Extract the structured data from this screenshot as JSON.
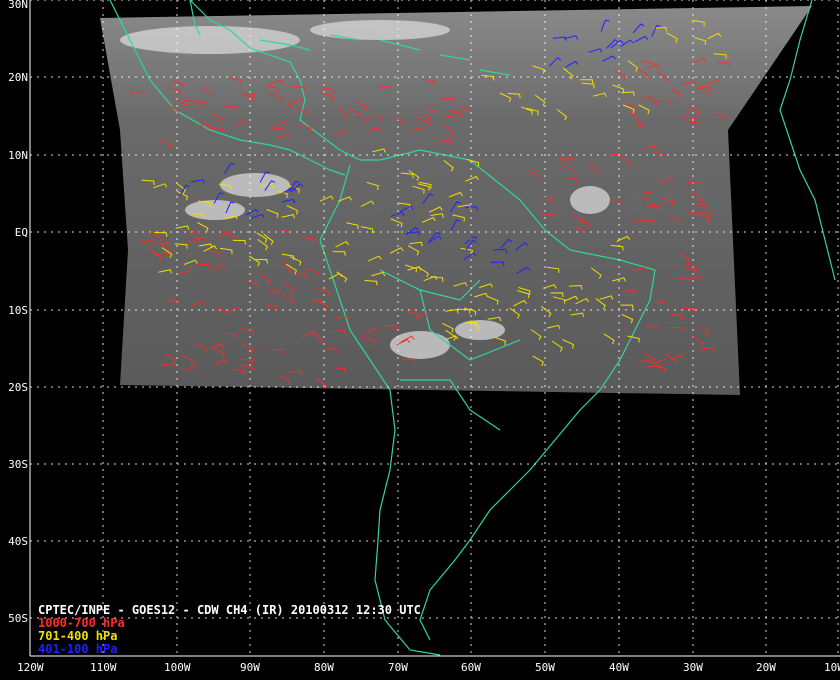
{
  "caption": {
    "title": "CPTEC/INPE - GOES12 - CDW CH4 (IR) 20100312 12:30 UTC",
    "legend": [
      {
        "label": "1000-700 hPa",
        "color": "#ff2a2a"
      },
      {
        "label": "701-400 hPa",
        "color": "#f0e000"
      },
      {
        "label": "401-100 hPa",
        "color": "#2020ff"
      }
    ]
  },
  "axes": {
    "lat_labels": [
      "30N",
      "20N",
      "10N",
      "EQ",
      "10S",
      "20S",
      "30S",
      "40S",
      "50S"
    ],
    "lon_labels": [
      "120W",
      "110W",
      "100W",
      "90W",
      "80W",
      "70W",
      "60W",
      "50W",
      "40W",
      "30W",
      "20W",
      "10W"
    ]
  },
  "colors": {
    "coast": "#2fd6a0",
    "grid": "#ffffff",
    "background": "#000000"
  }
}
